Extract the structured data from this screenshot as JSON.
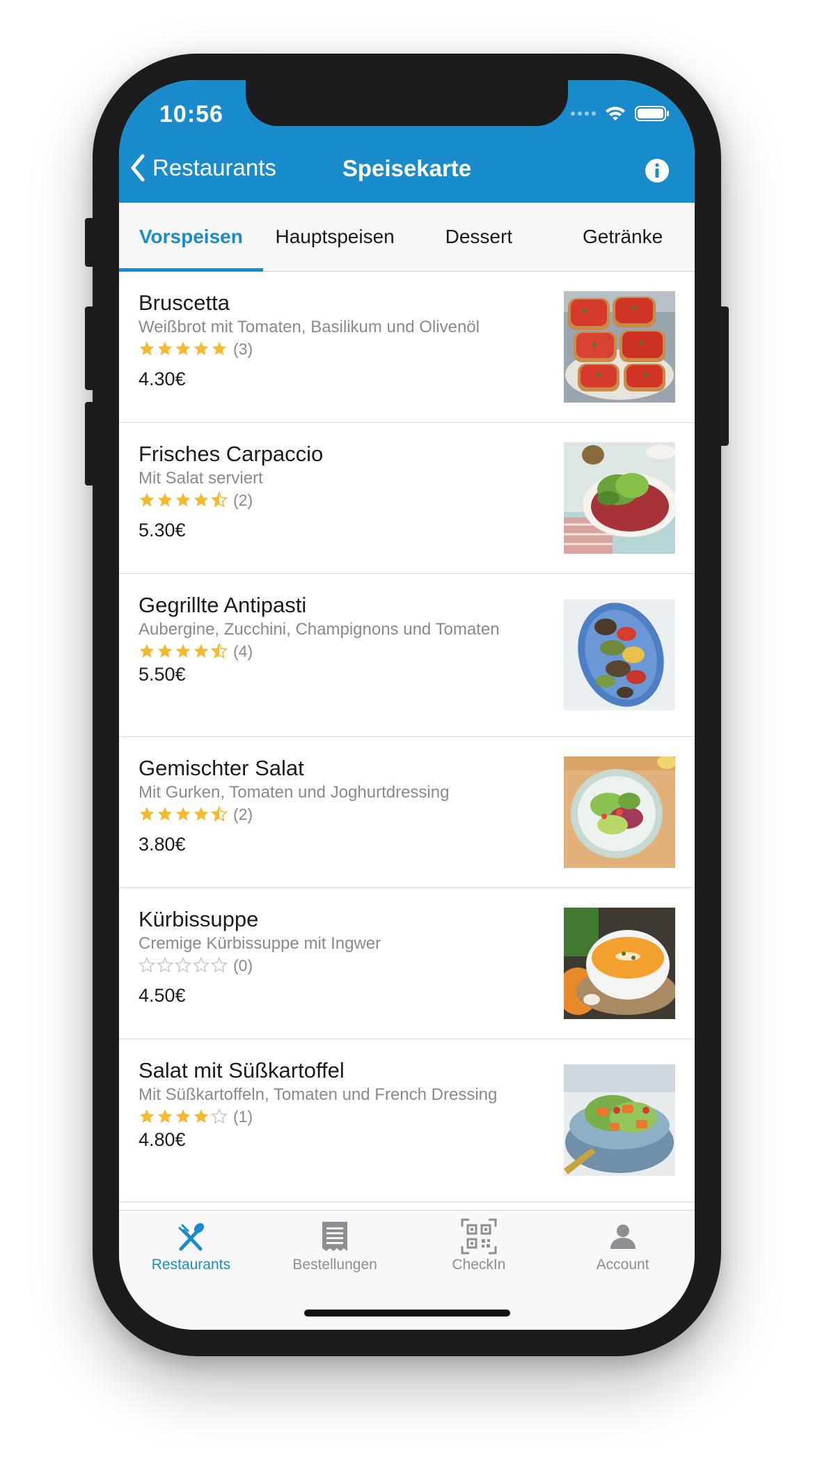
{
  "status_bar": {
    "time": "10:56"
  },
  "nav": {
    "back_label": "Restaurants",
    "title": "Speisekarte"
  },
  "category_tabs": [
    {
      "label": "Vorspeisen",
      "active": true
    },
    {
      "label": "Hauptspeisen",
      "active": false
    },
    {
      "label": "Dessert",
      "active": false
    },
    {
      "label": "Getränke",
      "active": false
    }
  ],
  "menu_items": [
    {
      "name": "Bruscetta",
      "description": "Weißbrot mit Tomaten, Basilikum und Olivenöl",
      "rating": 5,
      "rating_count": "(3)",
      "price": "4.30€",
      "image": "bruschetta-photo"
    },
    {
      "name": "Frisches Carpaccio",
      "description": "Mit Salat serviert",
      "rating": 4.5,
      "rating_count": "(2)",
      "price": "5.30€",
      "image": "carpaccio-photo"
    },
    {
      "name": "Gegrillte Antipasti",
      "description": "Aubergine, Zucchini, Champignons und Tomaten",
      "rating": 4.5,
      "rating_count": "(4)",
      "price": "5.50€",
      "image": "antipasti-photo"
    },
    {
      "name": "Gemischter Salat",
      "description": "Mit Gurken, Tomaten und Joghurtdressing",
      "rating": 4.5,
      "rating_count": "(2)",
      "price": "3.80€",
      "image": "mixed-salad-photo"
    },
    {
      "name": "Kürbissuppe",
      "description": "Cremige Kürbissuppe mit Ingwer",
      "rating": 0,
      "rating_count": "(0)",
      "price": "4.50€",
      "image": "pumpkin-soup-photo"
    },
    {
      "name": "Salat mit Süßkartoffel",
      "description": "Mit Süßkartoffeln, Tomaten und French Dressing",
      "rating": 4,
      "rating_count": "(1)",
      "price": "4.80€",
      "image": "sweet-potato-salad-photo"
    }
  ],
  "tab_bar": [
    {
      "label": "Restaurants",
      "icon": "fork-spoon-icon",
      "active": true
    },
    {
      "label": "Bestellungen",
      "icon": "receipt-icon",
      "active": false
    },
    {
      "label": "CheckIn",
      "icon": "qr-code-icon",
      "active": false
    },
    {
      "label": "Account",
      "icon": "person-icon",
      "active": false
    }
  ],
  "colors": {
    "accent": "#1a8ccb",
    "star": "#f5b82e",
    "star_empty": "#c7c7cc",
    "text_secondary": "#8a8a8e"
  }
}
